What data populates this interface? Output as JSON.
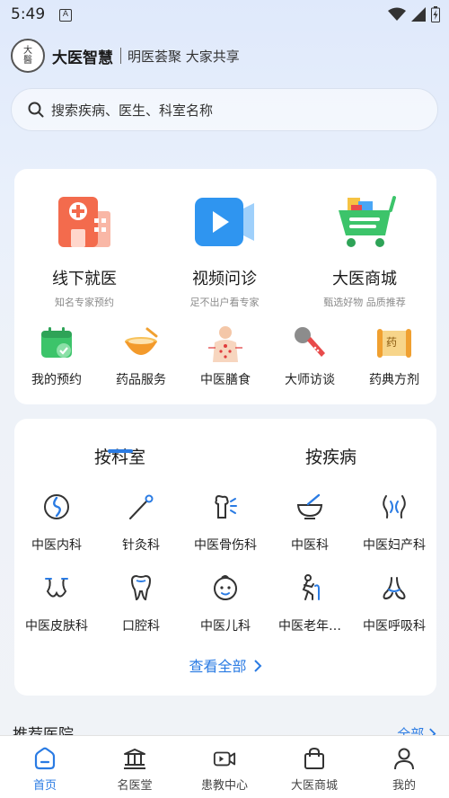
{
  "status_bar": {
    "time": "5:49",
    "app_icon": "A"
  },
  "header": {
    "logo_chars": [
      "大",
      "醫"
    ],
    "brand": "大医智慧",
    "slogan": "明医荟聚 大家共享"
  },
  "search": {
    "placeholder": "搜索疾病、医生、科室名称"
  },
  "services": [
    {
      "label": "线下就医",
      "sub": "知名专家预约",
      "icon": "hospital-icon"
    },
    {
      "label": "视频问诊",
      "sub": "足不出户看专家",
      "icon": "video-icon"
    },
    {
      "label": "大医商城",
      "sub": "甄选好物 品质推荐",
      "icon": "shopping-cart-icon"
    }
  ],
  "quick_links": [
    {
      "label": "我的预约",
      "icon": "calendar-icon"
    },
    {
      "label": "药品服务",
      "icon": "medicine-bowl-icon"
    },
    {
      "label": "中医膳食",
      "icon": "acupoint-body-icon"
    },
    {
      "label": "大师访谈",
      "icon": "microphone-icon"
    },
    {
      "label": "药典方剂",
      "icon": "scroll-icon",
      "icon_text": "药"
    }
  ],
  "department_tabs": [
    {
      "label": "按科室"
    },
    {
      "label": "按疾病"
    }
  ],
  "active_tab": "按科室",
  "departments": [
    {
      "label": "中医内科",
      "icon": "stomach-icon"
    },
    {
      "label": "针灸科",
      "icon": "acupuncture-needle-icon"
    },
    {
      "label": "中医骨伤科",
      "icon": "bone-icon"
    },
    {
      "label": "中医科",
      "icon": "mortar-icon"
    },
    {
      "label": "中医妇产科",
      "icon": "uterus-icon"
    },
    {
      "label": "中医皮肤科",
      "icon": "skin-icon"
    },
    {
      "label": "口腔科",
      "icon": "tooth-icon"
    },
    {
      "label": "中医儿科",
      "icon": "child-face-icon"
    },
    {
      "label": "中医老年…",
      "icon": "elderly-icon"
    },
    {
      "label": "中医呼吸科",
      "icon": "lungs-icon"
    }
  ],
  "view_all": "查看全部",
  "recommended": {
    "title": "推荐医院",
    "all": "全部"
  },
  "bottom_nav": [
    {
      "label": "首页",
      "icon": "home-icon",
      "active": true
    },
    {
      "label": "名医堂",
      "icon": "temple-icon",
      "active": false
    },
    {
      "label": "患教中心",
      "icon": "video-camera-icon",
      "active": false
    },
    {
      "label": "大医商城",
      "icon": "shopping-bag-icon",
      "active": false
    },
    {
      "label": "我的",
      "icon": "user-icon",
      "active": false
    }
  ],
  "colors": {
    "accent": "#2a7be3",
    "text": "#1b1b1b",
    "subtext": "#8a8a8a"
  }
}
